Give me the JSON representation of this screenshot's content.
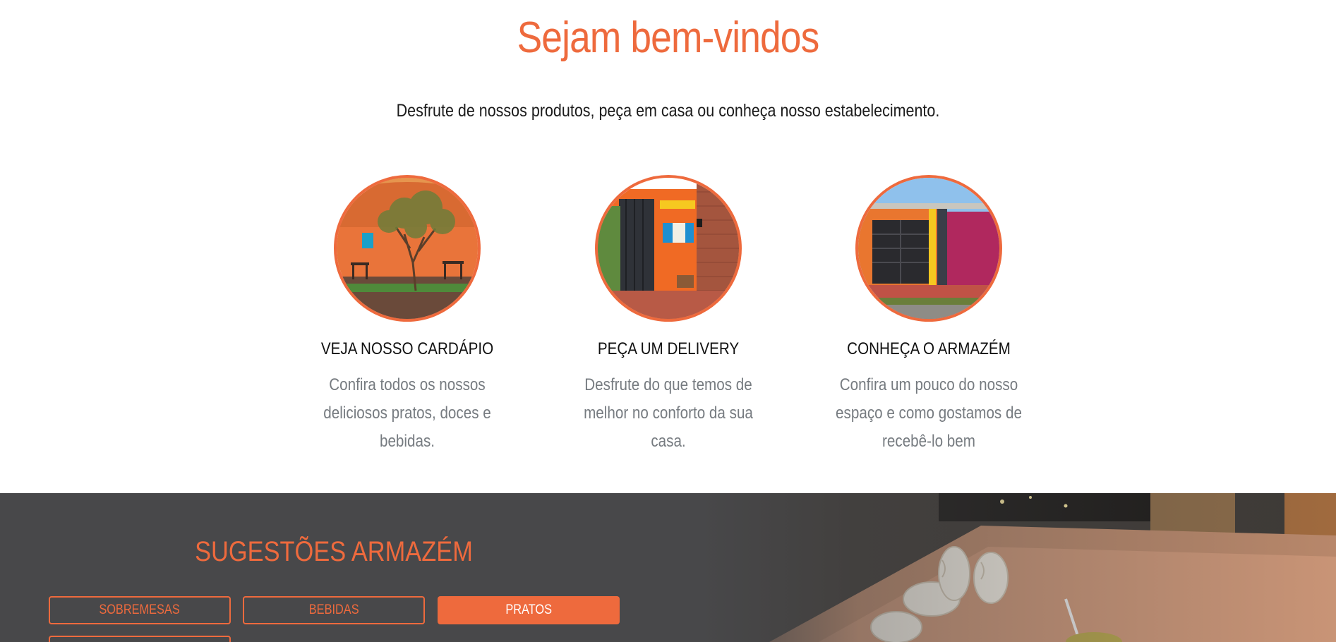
{
  "welcome": {
    "title": "Sejam bem-vindos",
    "subtitle": "Desfrute de nossos produtos, peça em casa ou conheça nosso estabelecimento."
  },
  "features": [
    {
      "title": "VEJA NOSSO CARDÁPIO",
      "description": "Confira todos os nossos deliciosos pratos, doces e bebidas.",
      "photo": "restaurant-courtyard-photo"
    },
    {
      "title": "PEÇA UM DELIVERY",
      "description": "Desfrute do que temos de melhor no conforto da sua casa.",
      "photo": "delivery-window-photo"
    },
    {
      "title": "CONHEÇA O ARMAZÉM",
      "description": "Confira um pouco do nosso espaço e como gostamos de recebê-lo bem",
      "photo": "storefront-photo"
    }
  ],
  "suggestions": {
    "title": "SUGESTÕES ARMAZÉM",
    "filters": [
      {
        "label": "SOBREMESAS",
        "active": false
      },
      {
        "label": "BEBIDAS",
        "active": false
      },
      {
        "label": "PRATOS",
        "active": true
      }
    ],
    "background_photo": "food-table-photo"
  },
  "colors": {
    "accent": "#ee6a3d",
    "dark_section": "#48484a",
    "text_dark": "#111111",
    "text_muted": "#767b80"
  }
}
